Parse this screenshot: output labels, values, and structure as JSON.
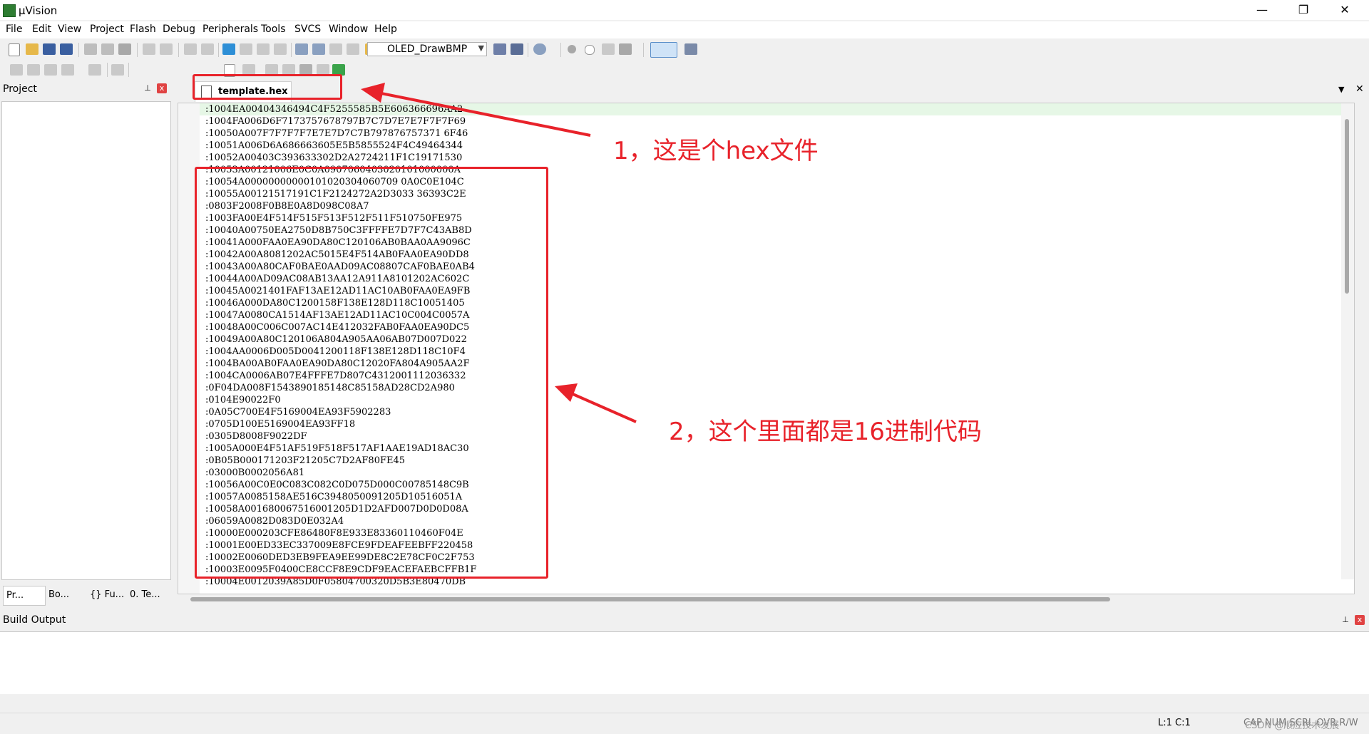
{
  "window": {
    "title": "µVision",
    "minimize": "—",
    "restore": "❐",
    "close": "✕"
  },
  "menu": [
    "File",
    "Edit",
    "View",
    "Project",
    "Flash",
    "Debug",
    "Peripherals",
    "Tools",
    "SVCS",
    "Window",
    "Help"
  ],
  "toolbar": {
    "target": "OLED_DrawBMP"
  },
  "project_pane": {
    "title": "Project",
    "pin": "⊥",
    "close": "x",
    "tabs": [
      "Pr...",
      "Bo...",
      "{} Fu...",
      "0. Te..."
    ]
  },
  "editor": {
    "tab_label": "template.hex",
    "tab_menu": "▼",
    "tab_close": "✕",
    "lines": [
      ":1004EA00404346494C4F5255585B5E606366696AA2",
      ":1004FA006D6F7173757678797B7C7D7E7E7F7F7F69",
      ":10050A007F7F7F7F7E7E7D7C7B797876757371 6F46",
      ":10051A006D6A686663605E5B5855524F4C49464344",
      ":10052A00403C393633302D2A2724211F1C19171530",
      ":10053A00121006E0C0A0907060403020101000000A",
      ":10054A00000000000101020304060709 0A0C0E104C",
      ":10055A00121517191C1F2124272A2D3033 36393C2E",
      ":0803F2008F0B8E0A8D098C08A7",
      ":1003FA00E4F514F515F513F512F511F510750FE975",
      ":10040A00750EA2750D8B750C3FFFFE7D7F7C43AB8D",
      ":10041A000FAA0EA90DA80C120106AB0BAA0AA9096C",
      ":10042A00A8081202AC5015E4F514AB0FAA0EA90DD8",
      ":10043A00A80CAF0BAE0AAD09AC08807CAF0BAE0AB4",
      ":10044A00AD09AC08AB13AA12A911A8101202AC602C",
      ":10045A0021401FAF13AE12AD11AC10AB0FAA0EA9FB",
      ":10046A000DA80C1200158F138E128D118C10051405",
      ":10047A0080CA1514AF13AE12AD11AC10C004C0057A",
      ":10048A00C006C007AC14E412032FAB0FAA0EA90DC5",
      ":10049A00A80C120106A804A905AA06AB07D007D022",
      ":1004AA0006D005D0041200118F138E128D118C10F4",
      ":1004BA00AB0FAA0EA90DA80C12020FA804A905AA2F",
      ":1004CA0006AB07E4FFFE7D807C4312001112036332",
      ":0F04DA008F1543890185148C85158AD28CD2A980",
      ":0104E90022F0",
      ":0A05C700E4F5169004EA93F5902283",
      ":0705D100E5169004EA93FF18",
      ":0305D8008F9022DF",
      ":1005A000E4F51AF519F518F517AF1AAE19AD18AC30",
      ":0B05B000171203F21205C7D2AF80FE45",
      ":03000B0002056A81",
      ":10056A00C0E0C083C082C0D075D000C00785148C9B",
      ":10057A0085158AE516C3948050091205D10516051A",
      ":10058A001680067516001205D1D2AFD007D0D0D08A",
      ":06059A0082D083D0E032A4",
      ":10000E000203CFE86480F8E933E83360110460F04E",
      ":10001E00ED33EC337009E8FCE9FDEAFEEBFF220458",
      ":10002E0060DED3EB9FEA9EE99DE8C2E78CF0C2F753",
      ":10003E0095F0400CE8CCF8E9CDF9EACEFAEBCFFB1F",
      ":10004E0012039A85D0F05804700320D5B3E80470DB"
    ]
  },
  "annotations": {
    "note1": "1，这是个hex文件",
    "note2": "2，这个里面都是16进制代码"
  },
  "build_output": {
    "title": "Build Output",
    "pin": "⊥",
    "close": "x"
  },
  "status": {
    "position": "L:1 C:1",
    "keys": "CAP NUM SCRL OVR R/W",
    "watermark": "CSDN @顺应技术发展"
  },
  "colors": {
    "annotation": "#e8222a",
    "current_line": "#e6f7e6"
  }
}
